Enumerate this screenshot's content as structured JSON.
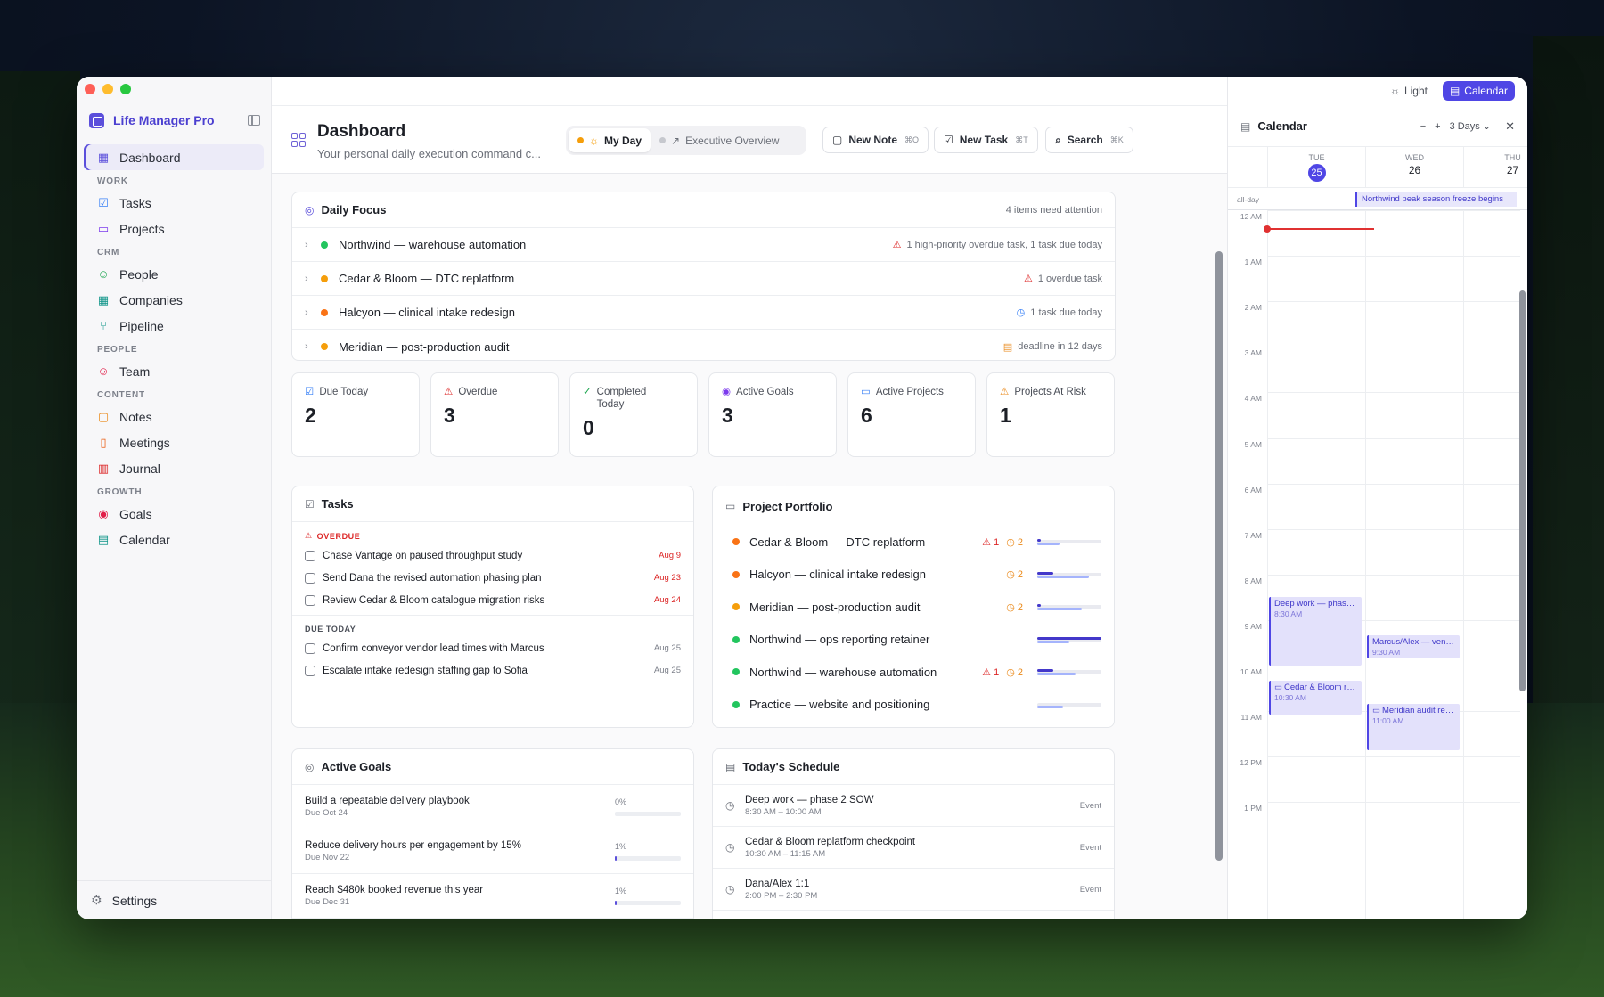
{
  "app": {
    "name": "Life Manager Pro",
    "theme_label": "Light",
    "calendar_toggle_label": "Calendar"
  },
  "sidebar": {
    "dashboard": "Dashboard",
    "sections": [
      {
        "title": "WORK",
        "items": [
          "Tasks",
          "Projects"
        ]
      },
      {
        "title": "CRM",
        "items": [
          "People",
          "Companies",
          "Pipeline"
        ]
      },
      {
        "title": "PEOPLE",
        "items": [
          "Team"
        ]
      },
      {
        "title": "CONTENT",
        "items": [
          "Notes",
          "Meetings",
          "Journal"
        ]
      },
      {
        "title": "GROWTH",
        "items": [
          "Goals",
          "Calendar"
        ]
      }
    ],
    "settings": "Settings"
  },
  "header": {
    "title": "Dashboard",
    "subtitle": "Your personal daily execution command c...",
    "modes": [
      "My Day",
      "Executive Overview"
    ],
    "new_note": "New Note",
    "new_note_kbd": "⌘O",
    "new_task": "New Task",
    "new_task_kbd": "⌘T",
    "search": "Search",
    "search_kbd": "⌘K"
  },
  "daily_focus": {
    "title": "Daily Focus",
    "summary": "4 items need attention",
    "items": [
      {
        "name": "Northwind — warehouse automation",
        "note": "1 high-priority overdue task, 1 task due today",
        "dot": "#22c55e"
      },
      {
        "name": "Cedar & Bloom — DTC replatform",
        "note": "1 overdue task",
        "dot": "#f59e0b"
      },
      {
        "name": "Halcyon — clinical intake redesign",
        "note": "1 task due today",
        "dot": "#f97316"
      },
      {
        "name": "Meridian — post-production audit",
        "note": "deadline in 12 days",
        "dot": "#f59e0b"
      }
    ]
  },
  "stats": [
    {
      "label": "Due Today",
      "value": "2"
    },
    {
      "label": "Overdue",
      "value": "3"
    },
    {
      "label": "Completed Today",
      "value": "0"
    },
    {
      "label": "Active Goals",
      "value": "3"
    },
    {
      "label": "Active Projects",
      "value": "6"
    },
    {
      "label": "Projects At Risk",
      "value": "1"
    }
  ],
  "tasks": {
    "title": "Tasks",
    "overdue_label": "OVERDUE",
    "overdue": [
      {
        "title": "Chase Vantage on paused throughput study",
        "date": "Aug 9"
      },
      {
        "title": "Send Dana the revised automation phasing plan",
        "date": "Aug 23"
      },
      {
        "title": "Review Cedar & Bloom catalogue migration risks",
        "date": "Aug 24"
      }
    ],
    "due_today_label": "DUE TODAY",
    "due_today": [
      {
        "title": "Confirm conveyor vendor lead times with Marcus",
        "date": "Aug 25"
      },
      {
        "title": "Escalate intake redesign staffing gap to Sofia",
        "date": "Aug 25"
      }
    ]
  },
  "portfolio": {
    "title": "Project Portfolio",
    "projects": [
      {
        "name": "Cedar & Bloom — DTC replatform",
        "dot": "#f97316",
        "risk": "1",
        "clock": "2",
        "done": 0.05,
        "progress": 0.35
      },
      {
        "name": "Halcyon — clinical intake redesign",
        "dot": "#f97316",
        "risk": "",
        "clock": "2",
        "done": 0.25,
        "progress": 0.8
      },
      {
        "name": "Meridian — post-production audit",
        "dot": "#f59e0b",
        "risk": "",
        "clock": "2",
        "done": 0.05,
        "progress": 0.7
      },
      {
        "name": "Northwind — ops reporting retainer",
        "dot": "#22c55e",
        "risk": "",
        "clock": "",
        "done": 1.0,
        "progress": 0.5
      },
      {
        "name": "Northwind — warehouse automation",
        "dot": "#22c55e",
        "risk": "1",
        "clock": "2",
        "done": 0.25,
        "progress": 0.6
      },
      {
        "name": "Practice — website and positioning",
        "dot": "#22c55e",
        "risk": "",
        "clock": "",
        "done": 0.0,
        "progress": 0.4
      }
    ]
  },
  "goals": {
    "title": "Active Goals",
    "items": [
      {
        "title": "Build a repeatable delivery playbook",
        "due": "Due Oct 24",
        "pct": "0%",
        "value": 0
      },
      {
        "title": "Reduce delivery hours per engagement by 15%",
        "due": "Due Nov 22",
        "pct": "1%",
        "value": 0.01
      },
      {
        "title": "Reach $480k booked revenue this year",
        "due": "Due Dec 31",
        "pct": "1%",
        "value": 0.01
      }
    ]
  },
  "schedule": {
    "title": "Today's Schedule",
    "items": [
      {
        "title": "Deep work — phase 2 SOW",
        "time": "8:30 AM – 10:00 AM",
        "kind": "Event"
      },
      {
        "title": "Cedar & Bloom replatform checkpoint",
        "time": "10:30 AM – 11:15 AM",
        "kind": "Event"
      },
      {
        "title": "Dana/Alex 1:1",
        "time": "2:00 PM – 2:30 PM",
        "kind": "Event"
      }
    ]
  },
  "calendar": {
    "title": "Calendar",
    "range": "3 Days",
    "days": [
      {
        "name": "TUE",
        "num": "25",
        "today": true
      },
      {
        "name": "WED",
        "num": "26",
        "today": false
      },
      {
        "name": "THU",
        "num": "27",
        "today": false
      }
    ],
    "allday_label": "all-day",
    "allday_event": "Northwind peak season freeze begins",
    "hours": [
      "12 AM",
      "1 AM",
      "2 AM",
      "3 AM",
      "4 AM",
      "5 AM",
      "6 AM",
      "7 AM",
      "8 AM",
      "9 AM",
      "10 AM",
      "11 AM",
      "12 PM",
      "1 PM"
    ],
    "events": [
      {
        "title": "Deep work — phase 2...",
        "time": "8:30 AM",
        "day": 0,
        "start": 8.5,
        "end": 10.0,
        "video": false
      },
      {
        "title": "Cedar & Bloom repl...",
        "time": "10:30 AM",
        "day": 0,
        "start": 10.33,
        "end": 11.08,
        "video": true
      },
      {
        "title": "Marcus/Alex — vendo...",
        "time": "9:30 AM",
        "day": 1,
        "start": 9.33,
        "end": 9.85,
        "video": false
      },
      {
        "title": "Meridian audit read...",
        "time": "11:00 AM",
        "day": 1,
        "start": 10.85,
        "end": 11.85,
        "video": true
      }
    ]
  },
  "colors": {
    "accent": "#4f46e5",
    "danger": "#dc2626",
    "warning": "#ea8a1b",
    "info": "#3b82f6"
  }
}
